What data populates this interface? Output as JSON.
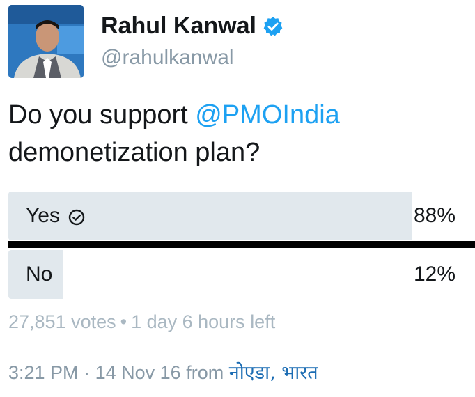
{
  "author": {
    "display_name": "Rahul Kanwal",
    "handle": "@rahulkanwal",
    "verified_icon": "verified-badge-icon",
    "avatar_icon": "profile-photo"
  },
  "tweet": {
    "text_before": "Do you support ",
    "mention": "@PMOIndia",
    "text_after": " demonetization plan?"
  },
  "poll": {
    "options": [
      {
        "label": "Yes",
        "percent": "88%",
        "fill_fraction": 0.88,
        "selected": true,
        "selected_icon": "check-circle-icon"
      },
      {
        "label": "No",
        "percent": "12%",
        "fill_fraction": 0.12,
        "selected": false
      }
    ],
    "votes": "27,851 votes",
    "separator": "•",
    "time_left": "1 day 6 hours left"
  },
  "footer": {
    "time": "3:21 PM",
    "separator": "·",
    "date": "14 Nov 16",
    "from_label": "from",
    "location": "नोएडा, भारत"
  },
  "colors": {
    "mention": "#1da1f2",
    "poll_fill": "#e1e8ed",
    "muted": "#8899a6",
    "location": "#1b6cb3",
    "verified": "#1da1f2"
  }
}
